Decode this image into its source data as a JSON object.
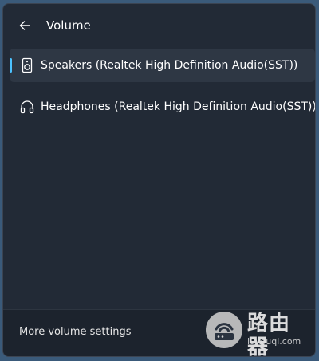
{
  "header": {
    "title": "Volume",
    "back_icon": "arrow-left-icon"
  },
  "devices": [
    {
      "label": "Speakers (Realtek High Definition Audio(SST))",
      "icon": "speaker-icon",
      "selected": true
    },
    {
      "label": "Headphones (Realtek High Definition Audio(SST))",
      "icon": "headphones-icon",
      "selected": false
    }
  ],
  "footer": {
    "more_label": "More volume settings"
  },
  "watermark": {
    "main": "路由器",
    "sub": "luyouqi.com"
  },
  "colors": {
    "accent": "#4cc2ff",
    "panel_bg": "#222a36",
    "selected_bg": "#2e3744",
    "footer_bg": "#1c232d"
  }
}
